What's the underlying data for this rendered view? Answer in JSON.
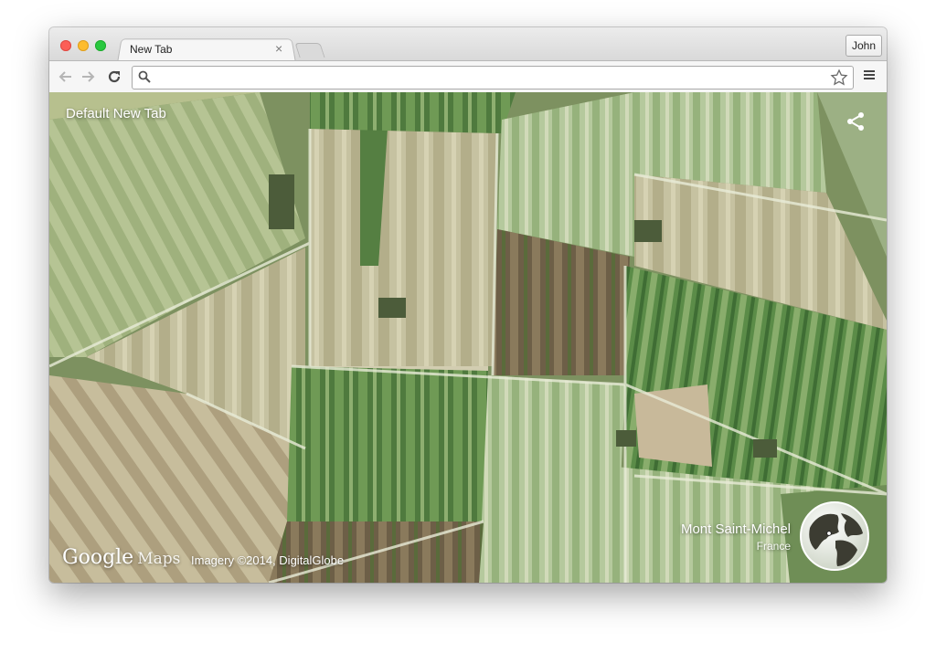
{
  "window": {
    "tab_title": "New Tab",
    "tab_close": "×",
    "profile_name": "John"
  },
  "toolbar": {
    "back_icon": "back-arrow-icon",
    "forward_icon": "forward-arrow-icon",
    "reload_icon": "reload-icon",
    "omnibox_value": "",
    "search_icon": "search-icon",
    "star_icon": "bookmark-star-icon",
    "menu_icon": "hamburger-menu-icon"
  },
  "page": {
    "title": "Default New Tab",
    "share_icon": "share-icon",
    "google": "Google",
    "maps": "Maps",
    "imagery_credit": "Imagery ©2014, DigitalGlobe",
    "place_name": "Mont Saint-Michel",
    "country": "France",
    "globe_icon": "globe-icon"
  },
  "colors": {
    "close": "#fc5f57",
    "minimize": "#fdbc2e",
    "maximize": "#29c83f"
  }
}
